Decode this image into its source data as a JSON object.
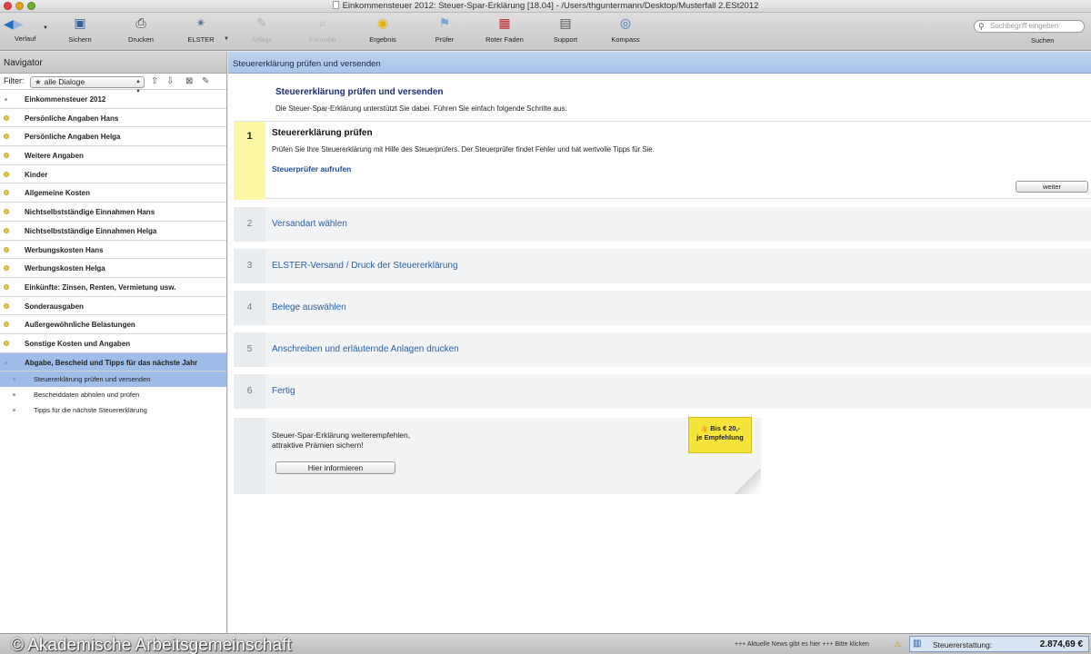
{
  "window": {
    "title": "Einkommensteuer 2012: Steuer-Spar-Erklärung [18.04] - /Users/thguntermann/Desktop/Musterfall 2.ESt2012"
  },
  "toolbar": {
    "verlauf": "Verlauf",
    "sichern": "Sichern",
    "drucken": "Drucken",
    "elster": "ELSTER",
    "anlage": "Anlage",
    "formular": "Formular",
    "ergebnis": "Ergebnis",
    "pruefer": "Prüfer",
    "roter_faden": "Roter Faden",
    "support": "Support",
    "kompass": "Kompass",
    "search_placeholder": "Suchbegriff eingeben",
    "search_label": "Suchen"
  },
  "navigator": {
    "title": "Navigator",
    "filter_label": "Filter:",
    "filter_value": "alle Dialoge",
    "items": [
      {
        "label": "Einkommensteuer 2012"
      },
      {
        "label": "Persönliche Angaben Hans"
      },
      {
        "label": "Persönliche Angaben Helga"
      },
      {
        "label": "Weitere Angaben"
      },
      {
        "label": "Kinder"
      },
      {
        "label": "Allgemeine Kosten"
      },
      {
        "label": "Nichtselbstständige Einnahmen Hans"
      },
      {
        "label": "Nichtselbstständige Einnahmen Helga"
      },
      {
        "label": "Werbungskosten Hans"
      },
      {
        "label": "Werbungskosten Helga"
      },
      {
        "label": "Einkünfte: Zinsen, Renten, Vermietung usw."
      },
      {
        "label": "Sonderausgaben"
      },
      {
        "label": "Außergewöhnliche Belastungen"
      },
      {
        "label": "Sonstige Kosten und Angaben"
      },
      {
        "label": "Abgabe, Bescheid und Tipps für das nächste Jahr"
      }
    ],
    "subitems": [
      {
        "label": "Steuererklärung prüfen und versenden"
      },
      {
        "label": "Bescheiddaten abholen und prüfen"
      },
      {
        "label": "Tipps für die nächste Steuererklärung"
      }
    ]
  },
  "content": {
    "header": "Steuererklärung prüfen und versenden",
    "intro_title": "Steuererklärung prüfen und versenden",
    "intro_text": "Die Steuer-Spar-Erklärung unterstützt Sie dabei. Führen Sie einfach folgende Schritte aus:",
    "step1": {
      "number": "1",
      "title": "Steuererklärung prüfen",
      "desc": "Prüfen Sie Ihre Steuererklärung mit Hilfe des Steuerprüfers. Der Steuerprüfer findet Fehler und hat wertvolle Tipps für Sie.",
      "link": "Steuerprüfer aufrufen",
      "button": "weiter"
    },
    "steps": [
      {
        "number": "2",
        "label": "Versandart wählen"
      },
      {
        "number": "3",
        "label": "ELSTER-Versand / Druck der Steuererklärung"
      },
      {
        "number": "4",
        "label": "Belege auswählen"
      },
      {
        "number": "5",
        "label": "Anschreiben und erläuternde Anlagen drucken"
      },
      {
        "number": "6",
        "label": "Fertig"
      }
    ],
    "promo": {
      "line1": "Steuer-Spar-Erklärung weiterempfehlen,",
      "line2": "attraktive Prämien sichern!",
      "button": "Hier informieren",
      "badge_line1": "Bis € 20,-",
      "badge_line2": "je Empfehlung"
    }
  },
  "statusbar": {
    "watermark": "© Akademische Arbeitsgemeinschaft",
    "news": "+++ Aktuelle News gibt es hier +++ Bitte klicken",
    "refund_label": "Steuererstattung:",
    "refund_amount": "2.874,69 €"
  }
}
